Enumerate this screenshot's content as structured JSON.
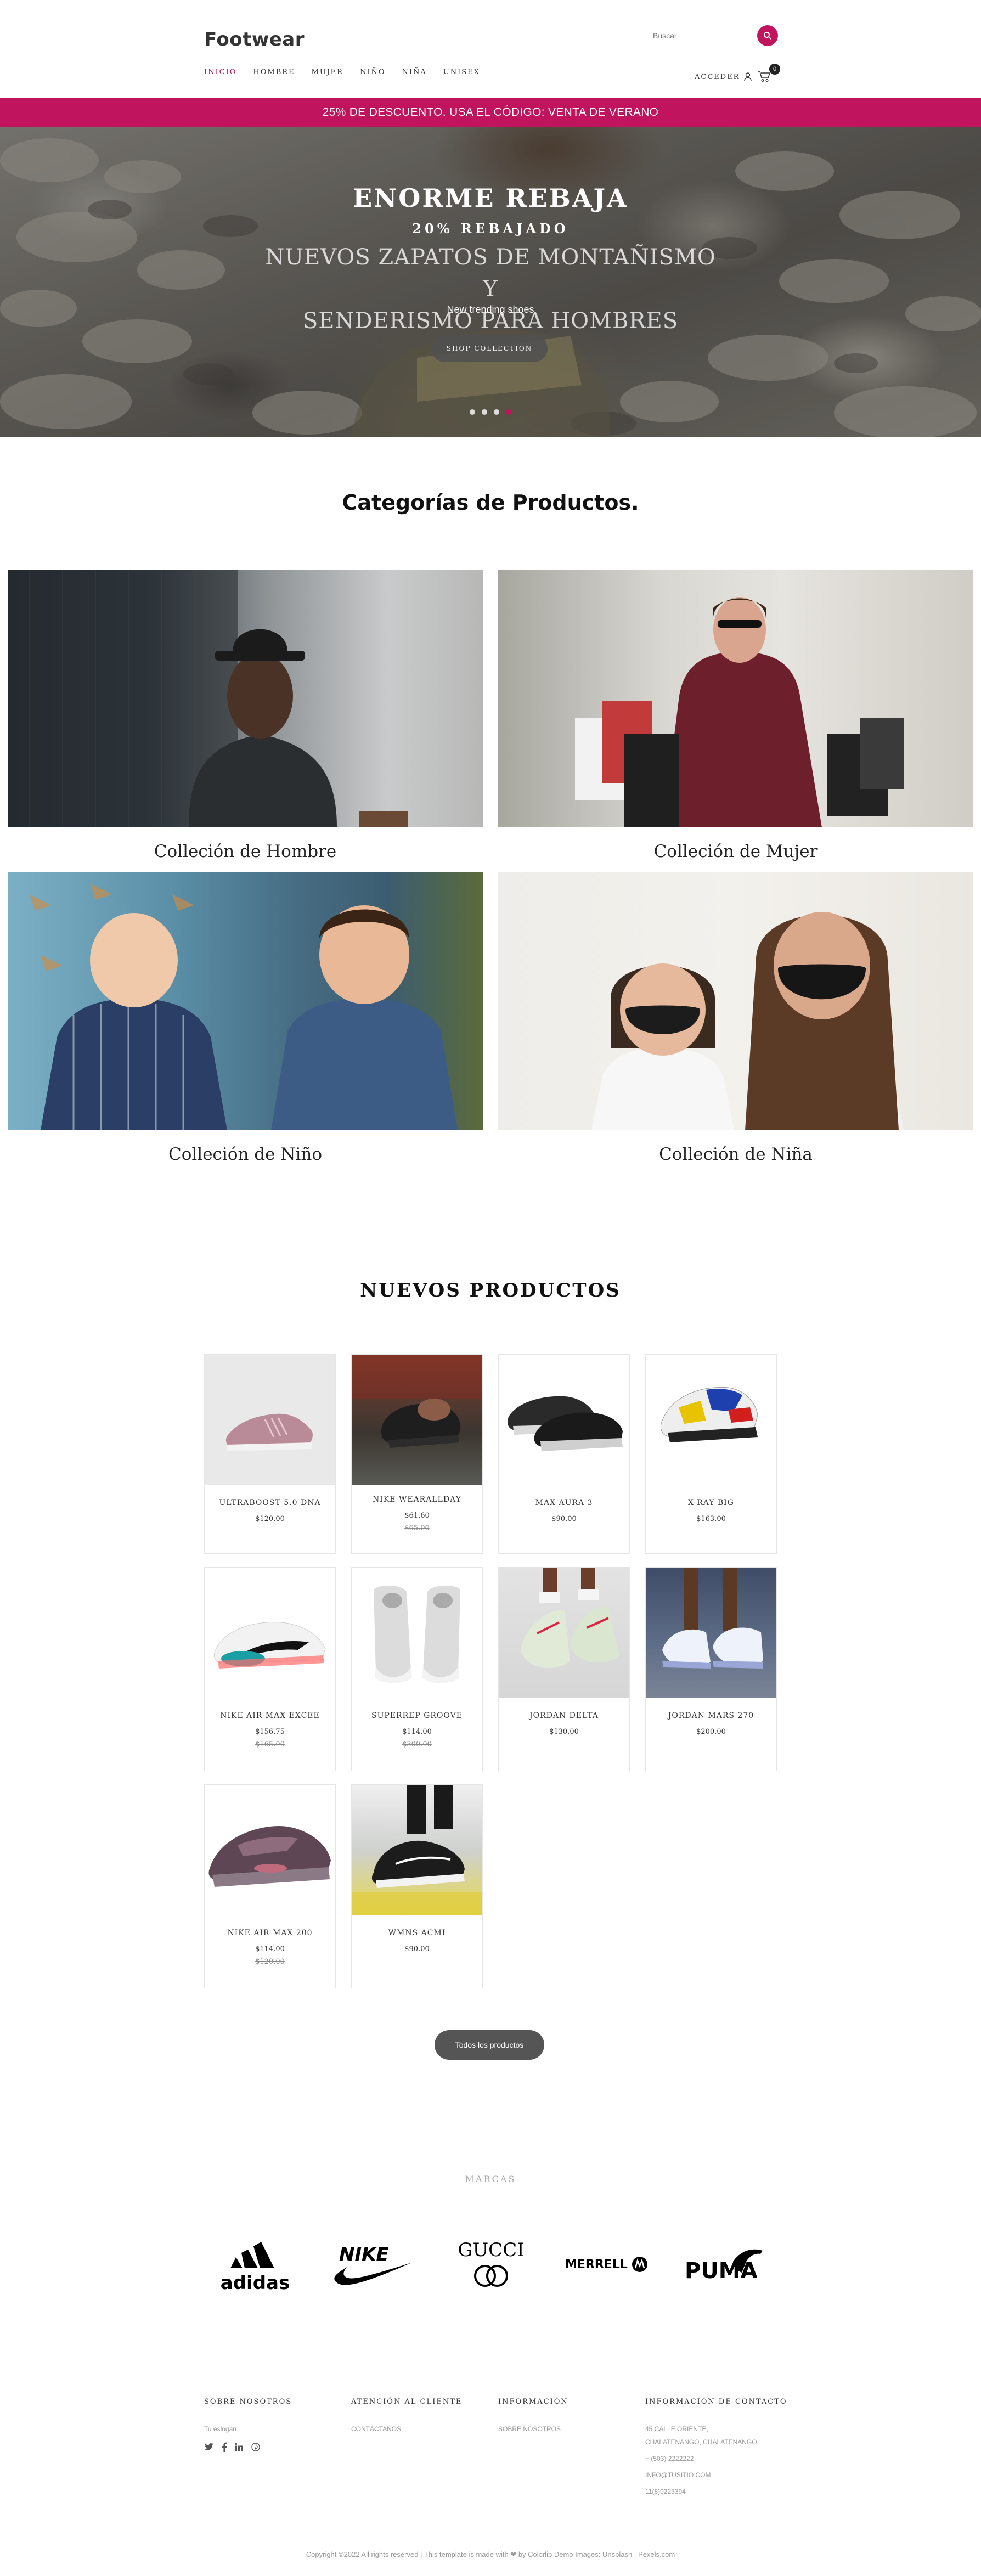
{
  "header": {
    "logo": "Footwear",
    "search_placeholder": "Buscar",
    "nav": [
      "INICIO",
      "HOMBRE",
      "MUJER",
      "NIÑO",
      "NIÑA",
      "UNISEX"
    ],
    "account_label": "ACCEDER",
    "cart_count": "0"
  },
  "promo": {
    "text": "25% DE DESCUENTO. USA EL CÓDIGO: VENTA DE VERANO"
  },
  "hero": {
    "title": "ENORME REBAJA",
    "subtitle": "20% REBAJADO",
    "heading_line1": "NUEVOS ZAPATOS DE MONTAÑISMO Y",
    "heading_line2": "SENDERISMO PARA HOMBRES",
    "tagline": "New trending shoes",
    "button": "SHOP COLLECTION"
  },
  "categories": {
    "title": "Categorías de Productos.",
    "items": [
      "Colleción de Hombre",
      "Colleción de Mujer",
      "Colleción de Niño",
      "Colleción de Niña"
    ]
  },
  "products": {
    "title": "NUEVOS PRODUCTOS",
    "items": [
      {
        "name": "ULTRABOOST 5.0 DNA",
        "price": "$120.00",
        "old_price": ""
      },
      {
        "name": "NIKE WEARALLDAY",
        "price": "$61.60",
        "old_price": "$65.00"
      },
      {
        "name": "MAX AURA 3",
        "price": "$90.00",
        "old_price": ""
      },
      {
        "name": "X-RAY BIG",
        "price": "$163.00",
        "old_price": ""
      },
      {
        "name": "NIKE AIR MAX EXCEE",
        "price": "$156.75",
        "old_price": "$165.00"
      },
      {
        "name": "SUPERREP GROOVE",
        "price": "$114.00",
        "old_price": "$300.00"
      },
      {
        "name": "JORDAN DELTA",
        "price": "$130.00",
        "old_price": ""
      },
      {
        "name": "JORDAN MARS 270",
        "price": "$200.00",
        "old_price": ""
      },
      {
        "name": "NIKE AIR MAX 200",
        "price": "$114.00",
        "old_price": "$120.00"
      },
      {
        "name": "WMNS ACMI",
        "price": "$90.00",
        "old_price": ""
      }
    ],
    "all_button": "Todos los productos"
  },
  "brands": {
    "title": "MARCAS",
    "items": [
      "adidas",
      "NIKE",
      "GUCCI",
      "MERRELL",
      "PUMA"
    ]
  },
  "footer": {
    "about": {
      "title": "SOBRE NOSOTROS",
      "text": "Tu eslogan"
    },
    "support": {
      "title": "ATENCIÓN AL CLIENTE",
      "link": "CONTÁCTANOS"
    },
    "info": {
      "title": "INFORMACIÓN",
      "link": "SOBRE NOSOTROS"
    },
    "contact": {
      "title": "INFORMACIÓN DE CONTACTO",
      "address_line1": "45 CALLE ORIENTE,",
      "address_line2": "CHALATENANGO, CHALATENANGO",
      "phone": "+ (503) 2222222",
      "email": "INFO@TUSITIO.COM",
      "fax": "11(8)9223394"
    },
    "copyright": "Copyright ©2022 All rights reserved | This template is made with ❤ by Colorlib Demo Images: Unsplash , Pexels.com"
  },
  "colors": {
    "accent": "#c0145e",
    "button_gray": "#555555"
  }
}
